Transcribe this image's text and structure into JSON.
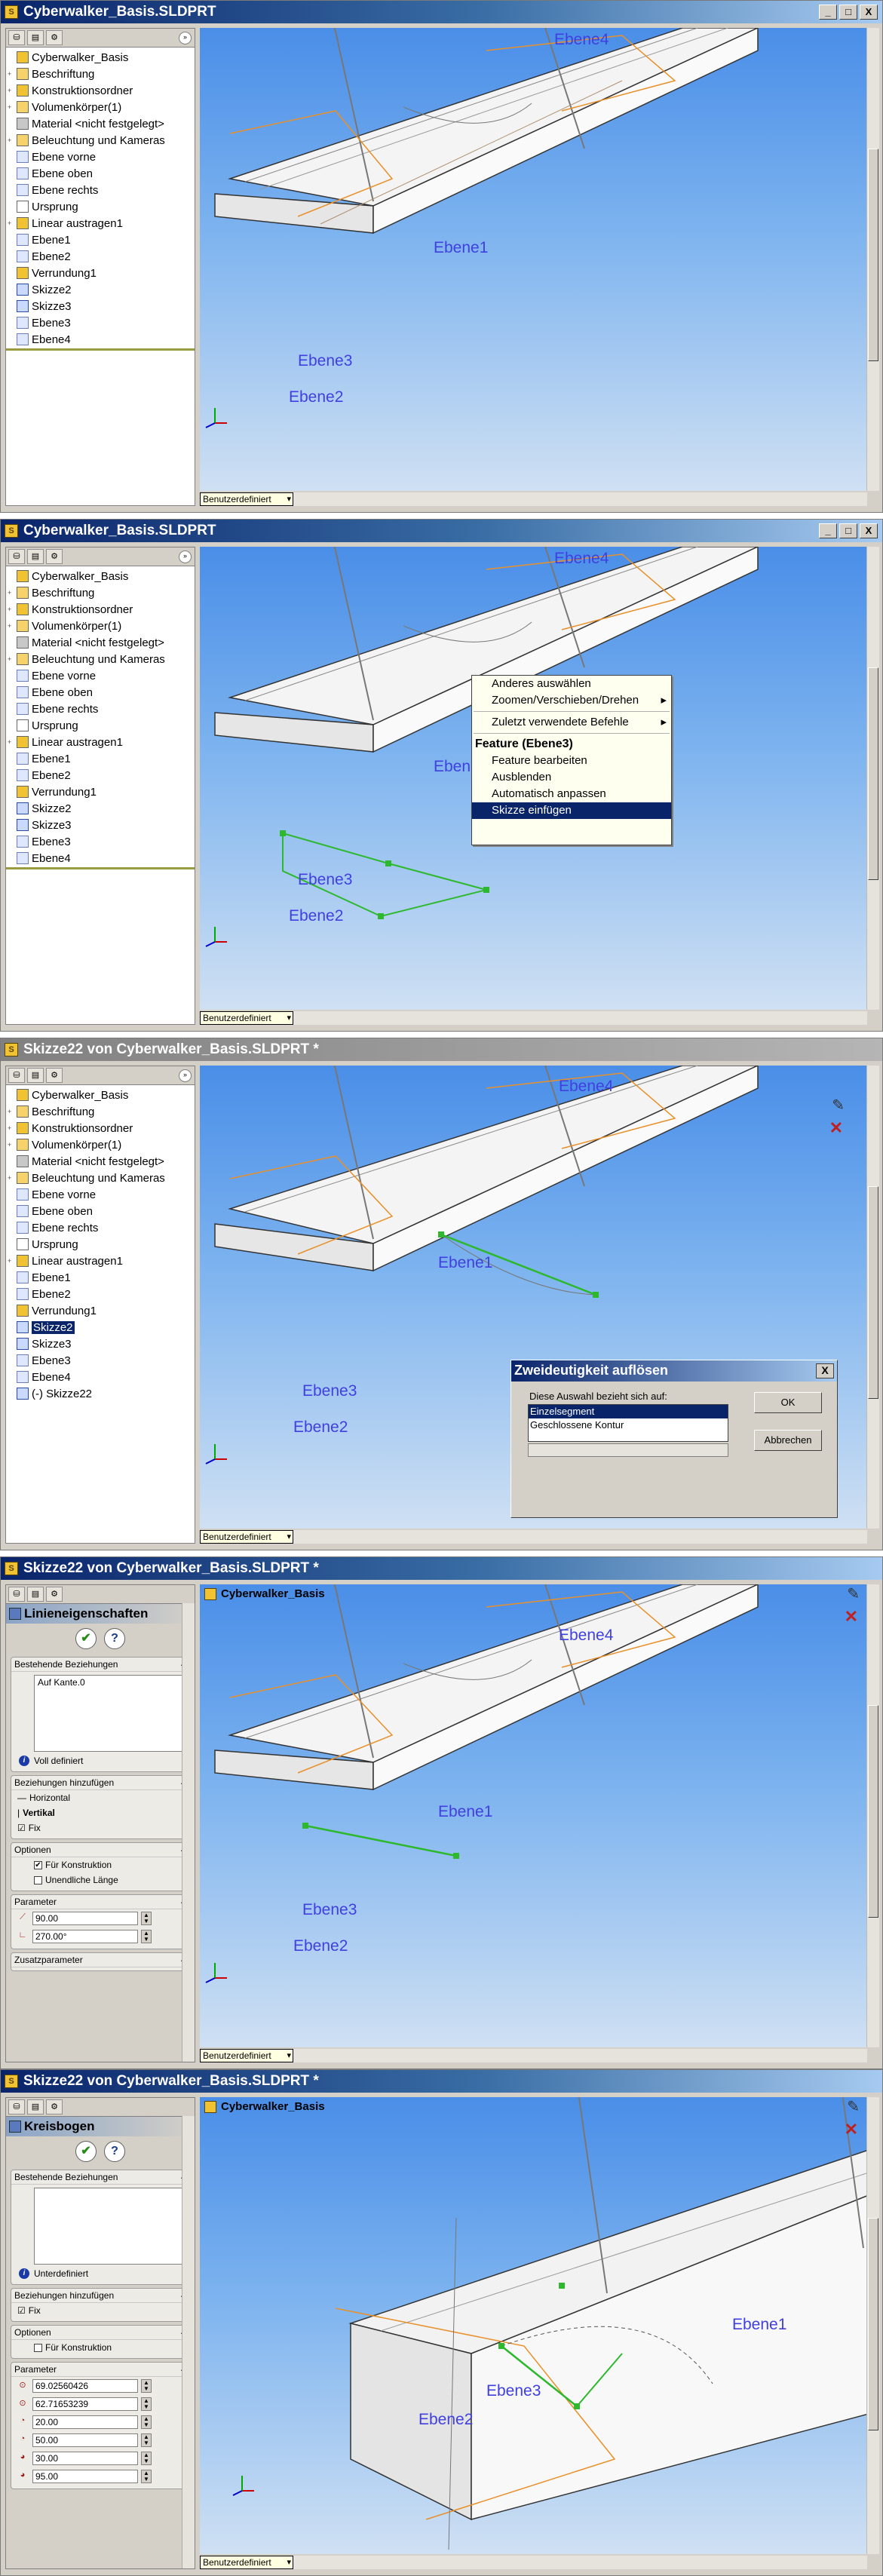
{
  "colors": {
    "title_active": "#0a246a",
    "plane_label": "#4040e0",
    "sketch_green": "#2db82d",
    "viewport_top": "#4a8ee8",
    "viewport_bottom": "#cfe0f3"
  },
  "window": {
    "title1": "Cyberwalker_Basis.SLDPRT",
    "title2": "Cyberwalker_Basis.SLDPRT",
    "title3": "Skizze22 von Cyberwalker_Basis.SLDPRT *",
    "title4": "Skizze22 von Cyberwalker_Basis.SLDPRT *",
    "title5": "Skizze22 von Cyberwalker_Basis.SLDPRT *",
    "minimize": "_",
    "maximize": "□",
    "close": "X"
  },
  "tree": {
    "root": "Cyberwalker_Basis",
    "items": [
      "Beschriftung",
      "Konstruktionsordner",
      "Volumenkörper(1)",
      "Material <nicht festgelegt>",
      "Beleuchtung und Kameras",
      "Ebene vorne",
      "Ebene oben",
      "Ebene rechts",
      "Ursprung",
      "Linear austragen1",
      "Ebene1",
      "Ebene2",
      "Verrundung1",
      "Skizze2",
      "Skizze3",
      "Ebene3",
      "Ebene4"
    ],
    "extra_item": "(-) Skizze22"
  },
  "planes": {
    "ebene1": "Ebene1",
    "ebene2": "Ebene2",
    "ebene3": "Ebene3",
    "ebene4": "Ebene4"
  },
  "viewport": {
    "view_orientation": "Benutzerdefiniert",
    "breadcrumb": "Cyberwalker_Basis"
  },
  "context_menu": {
    "items": [
      "Anderes auswählen",
      "Zoomen/Verschieben/Drehen",
      "Zuletzt verwendete Befehle",
      "Feature (Ebene3)",
      "Feature bearbeiten",
      "Ausblenden",
      "Automatisch anpassen",
      "Skizze einfügen"
    ]
  },
  "dialog": {
    "title": "Zweideutigkeit auflösen",
    "prompt": "Diese Auswahl bezieht sich auf:",
    "options": [
      "Einzelsegment",
      "Geschlossene Kontur"
    ],
    "ok": "OK",
    "cancel": "Abbrechen"
  },
  "line_props": {
    "title": "Linieneigenschaften",
    "existing_relations": "Bestehende Beziehungen",
    "relation_item": "Auf Kante.0",
    "status": "Voll definiert",
    "add_relations": "Beziehungen hinzufügen",
    "relations": [
      "Horizontal",
      "Vertikal",
      "Fix"
    ],
    "options": "Optionen",
    "for_construction": "Für Konstruktion",
    "infinite_length": "Unendliche Länge",
    "parameters": "Parameter",
    "length": "90.00",
    "angle": "270.00°",
    "extra_params": "Zusatzparameter"
  },
  "arc_props": {
    "title": "Kreisbogen",
    "existing_relations": "Bestehende Beziehungen",
    "status": "Unterdefiniert",
    "add_relations": "Beziehungen hinzufügen",
    "relations": [
      "Fix"
    ],
    "options": "Optionen",
    "for_construction": "Für Konstruktion",
    "parameters": "Parameter",
    "values": [
      "69.02560426",
      "62.71653239",
      "20.00",
      "50.00",
      "30.00",
      "95.00"
    ]
  }
}
